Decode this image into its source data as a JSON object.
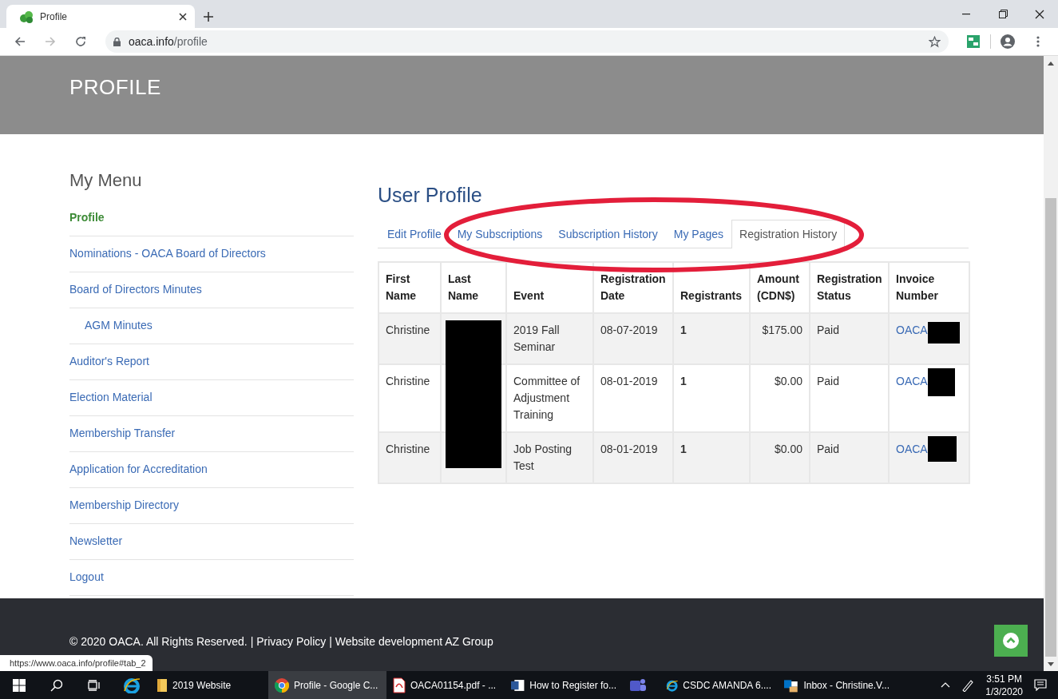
{
  "browser": {
    "tab_title": "Profile",
    "url_host": "oaca.info",
    "url_path": "/profile",
    "status_url": "https://www.oaca.info/profile#tab_2"
  },
  "header": {
    "title": "PROFILE"
  },
  "menu": {
    "title": "My Menu",
    "items": [
      {
        "label": "Profile",
        "selected": true
      },
      {
        "label": "Nominations - OACA Board of Directors",
        "selected": false
      },
      {
        "label": "Board of Directors Minutes",
        "selected": false,
        "children": [
          {
            "label": "AGM Minutes",
            "selected": false
          }
        ]
      },
      {
        "label": "Auditor's Report",
        "selected": false
      },
      {
        "label": "Election Material",
        "selected": false
      },
      {
        "label": "Membership Transfer",
        "selected": false
      },
      {
        "label": "Application for Accreditation",
        "selected": false
      },
      {
        "label": "Membership Directory",
        "selected": false
      },
      {
        "label": "Newsletter",
        "selected": false
      },
      {
        "label": "Logout",
        "selected": false
      }
    ]
  },
  "profile": {
    "title": "User Profile",
    "tabs": [
      {
        "label": "Edit Profile",
        "selected": false
      },
      {
        "label": "My Subscriptions",
        "selected": false
      },
      {
        "label": "Subscription History",
        "selected": false
      },
      {
        "label": "My Pages",
        "selected": false
      },
      {
        "label": "Registration History",
        "selected": true
      }
    ],
    "highlighted": true,
    "table": {
      "columns": [
        "First Name",
        "Last Name",
        "Event",
        "Registration Date",
        "Registrants",
        "Amount (CDN$)",
        "Registration Status",
        "Invoice Number"
      ],
      "rows": [
        {
          "first_name": "Christine",
          "last_name_redacted": true,
          "event": "2019 Fall Seminar",
          "date": "08-07-2019",
          "registrants": "1",
          "amount": "$175.00",
          "status": "Paid",
          "invoice": "OACA"
        },
        {
          "first_name": "Christine",
          "last_name_redacted": true,
          "event": "Committee of Adjustment Training",
          "date": "08-01-2019",
          "registrants": "1",
          "amount": "$0.00",
          "status": "Paid",
          "invoice": "OACA"
        },
        {
          "first_name": "Christine",
          "last_name_redacted": true,
          "event": "Job Posting Test",
          "date": "08-01-2019",
          "registrants": "1",
          "amount": "$0.00",
          "status": "Paid",
          "invoice": "OACA"
        }
      ]
    }
  },
  "footer": {
    "text": "© 2020 OACA. All Rights Reserved. | Privacy Policy | Website development AZ Group"
  },
  "taskbar": {
    "items": [
      {
        "kind": "explorer",
        "label": "2019 Website",
        "selected": false
      },
      {
        "kind": "chrome",
        "label": "Profile - Google C...",
        "selected": true
      },
      {
        "kind": "pdf",
        "label": "OACA01154.pdf - ...",
        "selected": false
      },
      {
        "kind": "word",
        "label": "How to Register fo...",
        "selected": false
      },
      {
        "kind": "teams",
        "selected": false
      },
      {
        "kind": "ie",
        "label": "CSDC AMANDA 6....",
        "selected": false
      },
      {
        "kind": "outlook",
        "label": "Inbox - Christine.V...",
        "selected": false
      }
    ],
    "time": "3:51 PM",
    "date": "1/3/2020"
  }
}
